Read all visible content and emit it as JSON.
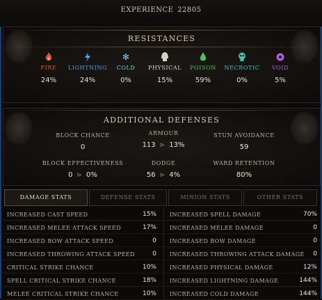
{
  "experience": {
    "label": "EXPERIENCE",
    "value": "22805"
  },
  "resistances": {
    "title": "RESISTANCES",
    "items": [
      {
        "name": "FIRE",
        "value": "24%",
        "icon": "fire-icon",
        "color": "#e0533a"
      },
      {
        "name": "LIGHTNING",
        "value": "24%",
        "icon": "lightning-icon",
        "color": "#4fa3ea"
      },
      {
        "name": "COLD",
        "value": "0%",
        "icon": "snowflake-icon",
        "color": "#7fcde8"
      },
      {
        "name": "PHYSICAL",
        "value": "15%",
        "icon": "physical-icon",
        "color": "#d8d2c6"
      },
      {
        "name": "POISON",
        "value": "59%",
        "icon": "poison-icon",
        "color": "#4ec25a"
      },
      {
        "name": "NECROTIC",
        "value": "0%",
        "icon": "necrotic-icon",
        "color": "#3fc7b3"
      },
      {
        "name": "VOID",
        "value": "5%",
        "icon": "void-icon",
        "color": "#b061d8"
      }
    ]
  },
  "defenses": {
    "title": "ADDITIONAL DEFENSES",
    "block_chance": {
      "label": "BLOCK CHANCE",
      "value": "0"
    },
    "armour": {
      "label": "ARMOUR",
      "value": "113",
      "derived": "13%"
    },
    "stun_avoidance": {
      "label": "STUN AVOIDANCE",
      "value": "59"
    },
    "block_effectiveness": {
      "label": "BLOCK EFFECTIVENESS",
      "value": "0",
      "derived": "0%"
    },
    "dodge": {
      "label": "DODGE",
      "value": "56",
      "derived": "4%"
    },
    "ward_retention": {
      "label": "WARD RETENTION",
      "value": "80%"
    }
  },
  "tabs": [
    {
      "label": "DAMAGE STATS",
      "active": true
    },
    {
      "label": "DEFENSE STATS",
      "active": false
    },
    {
      "label": "MINION STATS",
      "active": false
    },
    {
      "label": "OTHER STATS",
      "active": false
    }
  ],
  "stats": {
    "left": [
      {
        "label": "INCREASED CAST SPEED",
        "value": "15%"
      },
      {
        "label": "INCREASED MELEE ATTACK SPEED",
        "value": "17%"
      },
      {
        "label": "INCREASED BOW ATTACK SPEED",
        "value": "0"
      },
      {
        "label": "INCREASED THROWING ATTACK SPEED",
        "value": "0"
      },
      {
        "label": "CRITICAL STRIKE CHANCE",
        "value": "10%"
      },
      {
        "label": "SPELL CRITICAL STRIKE CHANCE",
        "value": "18%"
      },
      {
        "label": "MELEE CRITICAL STRIKE CHANCE",
        "value": "10%"
      }
    ],
    "right": [
      {
        "label": "INCREASED SPELL DAMAGE",
        "value": "70%"
      },
      {
        "label": "INCREASED MELEE DAMAGE",
        "value": "0"
      },
      {
        "label": "INCREASED BOW DAMAGE",
        "value": "0"
      },
      {
        "label": "INCREASED THROWING ATTACK DAMAGE",
        "value": "0"
      },
      {
        "label": "INCREASED PHYSICAL DAMAGE",
        "value": "12%"
      },
      {
        "label": "INCREASED LIGHTNING DAMAGE",
        "value": "144%"
      },
      {
        "label": "INCREASED COLD DAMAGE",
        "value": "144%"
      }
    ]
  }
}
